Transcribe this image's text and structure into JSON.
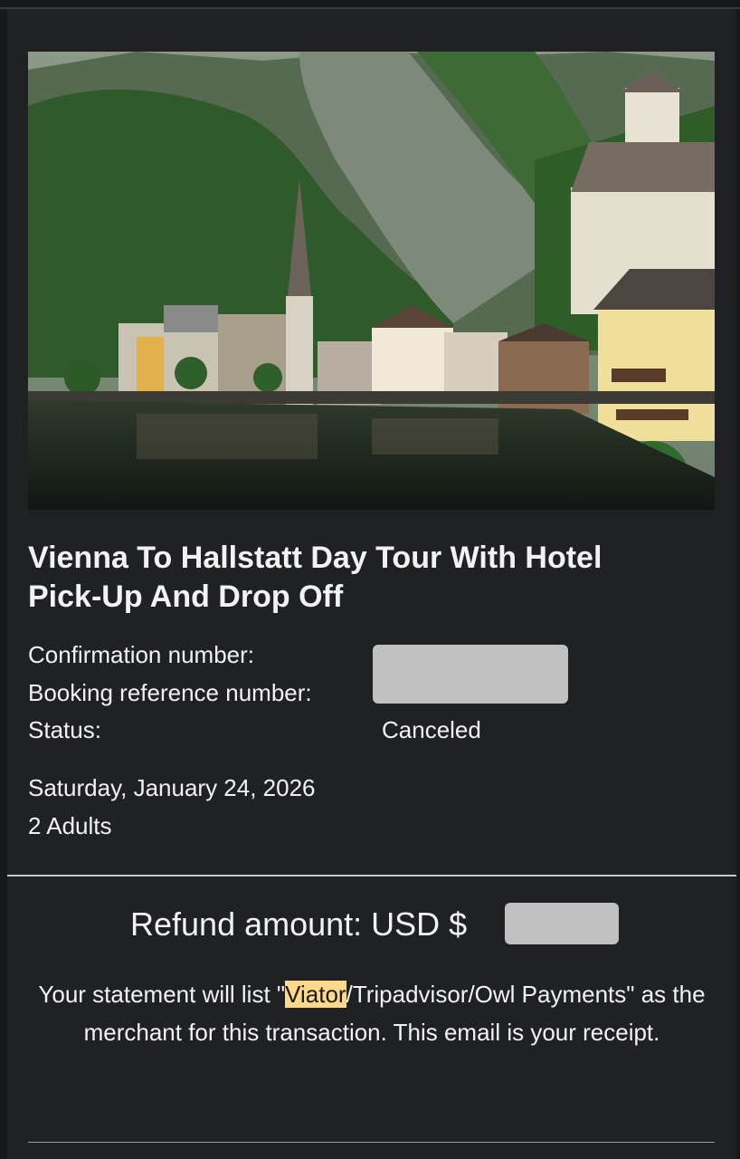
{
  "hero": {
    "image_label": "Hallstatt lakeside village with mountains"
  },
  "tour": {
    "title_line1": "Vienna To Hallstatt Day Tour With Hotel",
    "title_line2": "Pick-Up And Drop Off"
  },
  "booking": {
    "confirmation_label": "Confirmation number:",
    "reference_label": "Booking reference number:",
    "status_label": "Status:",
    "status_value": "Canceled",
    "date": "Saturday, January 24, 2026",
    "travelers": "2 Adults"
  },
  "refund": {
    "label": "Refund amount: USD $"
  },
  "statement": {
    "part1": "Your statement will list \"",
    "merchant_highlight": "Viator",
    "part2": "/Tripadvisor/Owl Payments\" as the merchant for this transaction. This email is your receipt."
  },
  "colors": {
    "background": "#17181b",
    "card": "#202125",
    "redaction": "#c0c0c0",
    "highlight": "#ffd98a"
  }
}
